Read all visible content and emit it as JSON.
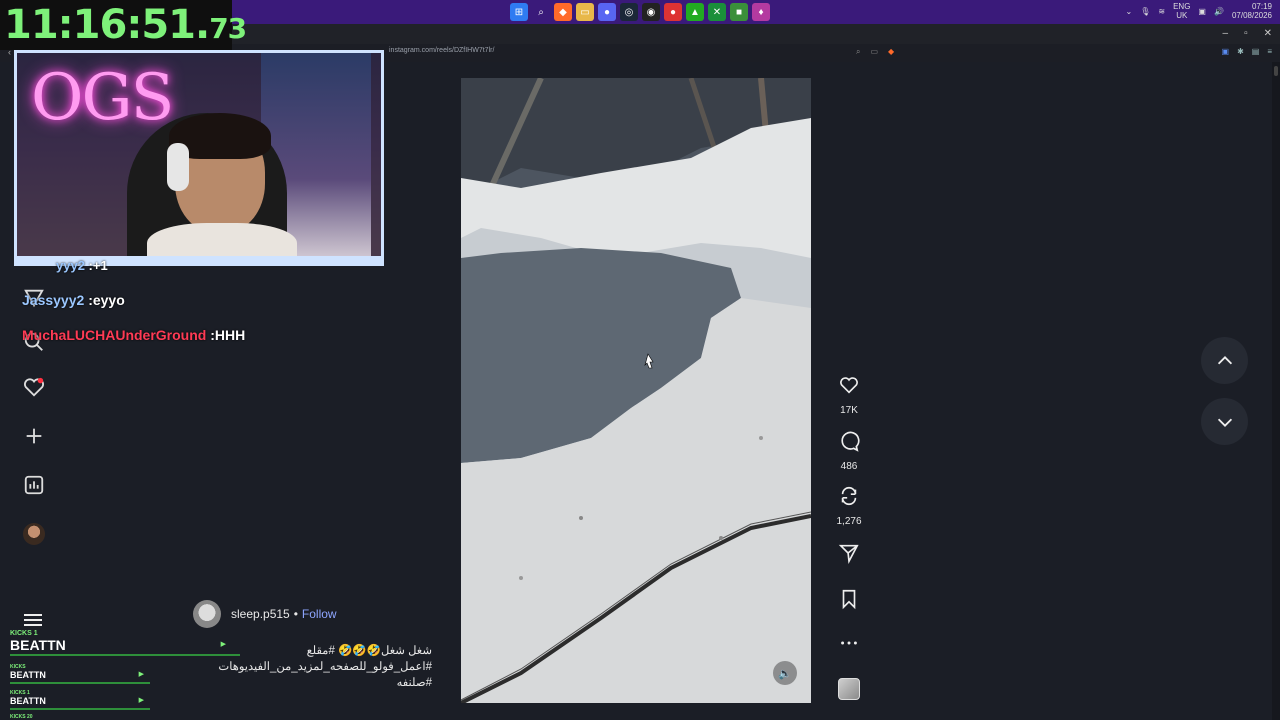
{
  "timer": {
    "main": "11:16:51.",
    "centis": "73"
  },
  "tray": {
    "lang_top": "ENG",
    "lang_bottom": "UK",
    "time": "07:19",
    "date": "07/08/2026"
  },
  "browser": {
    "url": "instagram.com/reels/DZfIHW7t7lr/"
  },
  "chat": [
    {
      "user": "yyy2",
      "message": ":+1",
      "user_color": "#9bc7ff"
    },
    {
      "user": "Jassyyy2",
      "message": ":eyyo",
      "user_color": "#9bc7ff"
    },
    {
      "user": "MuchaLUCHAUnderGround",
      "message": ":HHH",
      "user_color": "#ff3b55"
    }
  ],
  "reel": {
    "author": "sleep.p515",
    "separator": "•",
    "follow_label": "Follow",
    "caption_line1": "شغل شغل🤣🤣🤣 #مقلع",
    "caption_line2": "#اعمل_فولو_للصفحه_لمزيد_من_الفيديوهات",
    "caption_line3": "#صلنفه"
  },
  "actions": {
    "likes": "17K",
    "comments": "486",
    "reposts": "1,276"
  },
  "kicks": [
    {
      "label": "KICKS 1",
      "name": "BEATTN"
    },
    {
      "label": "KICKS",
      "name": "BEATTN"
    },
    {
      "label": "KICKS 1",
      "name": "BEATTN"
    },
    {
      "label": "KICKS 20",
      "name": ""
    }
  ],
  "icons": {
    "heart": "heart-icon",
    "comment": "comment-icon",
    "repost": "repost-icon",
    "share": "share-icon",
    "save": "bookmark-icon",
    "more": "more-icon"
  }
}
